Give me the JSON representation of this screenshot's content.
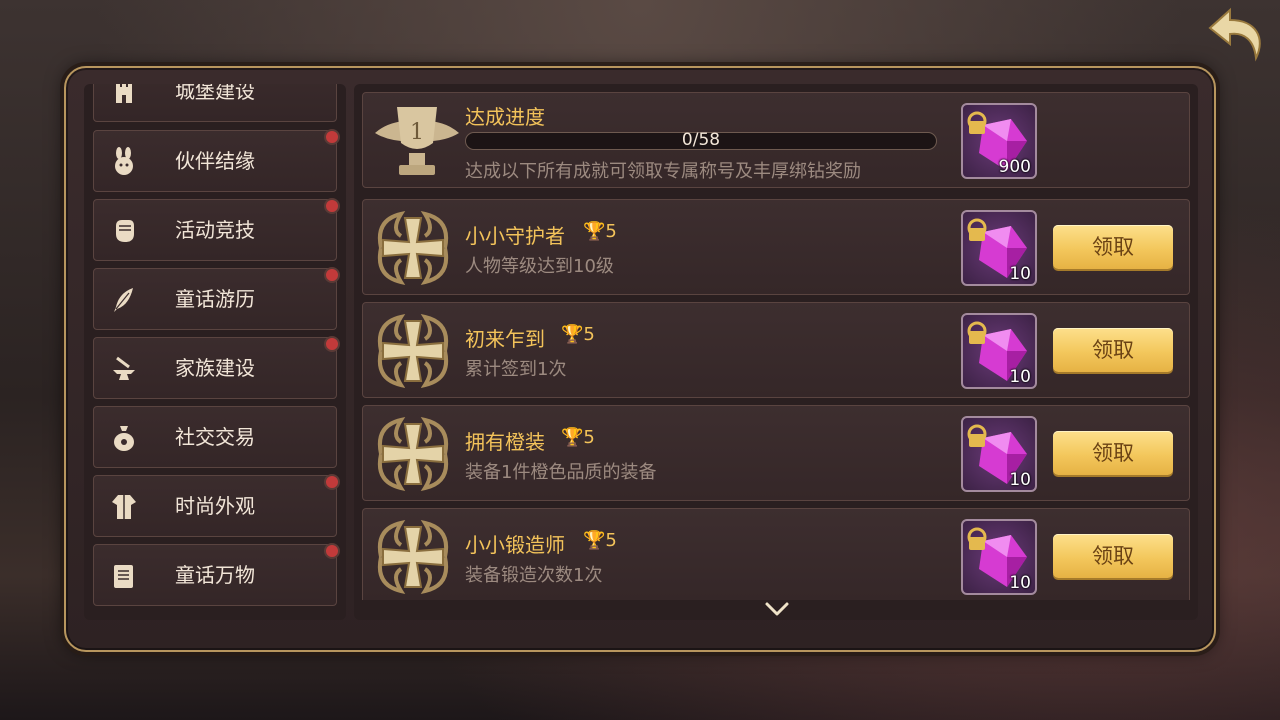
{
  "sidebar": {
    "items": [
      {
        "label": "城堡建设",
        "icon": "castle-icon",
        "badge": false
      },
      {
        "label": "伙伴结缘",
        "icon": "bunny-partner-icon",
        "badge": true
      },
      {
        "label": "活动竞技",
        "icon": "fist-icon",
        "badge": true
      },
      {
        "label": "童话游历",
        "icon": "feather-icon",
        "badge": true
      },
      {
        "label": "家族建设",
        "icon": "anvil-icon",
        "badge": true
      },
      {
        "label": "社交交易",
        "icon": "money-bag-icon",
        "badge": false
      },
      {
        "label": "时尚外观",
        "icon": "outfit-icon",
        "badge": true
      },
      {
        "label": "童话万物",
        "icon": "book-icon",
        "badge": true
      }
    ]
  },
  "progress": {
    "title": "达成进度",
    "value_text": "0/58",
    "value_fraction": 0,
    "desc": "达成以下所有成就可领取专属称号及丰厚绑钻奖励",
    "reward_qty": "900",
    "trophy_rank": "1"
  },
  "achievements": [
    {
      "title": "小小守护者",
      "points": "5",
      "desc": "人物等级达到10级",
      "reward_qty": "10",
      "button": "领取"
    },
    {
      "title": "初来乍到",
      "points": "5",
      "desc": "累计签到1次",
      "reward_qty": "10",
      "button": "领取"
    },
    {
      "title": "拥有橙装",
      "points": "5",
      "desc": "装备1件橙色品质的装备",
      "reward_qty": "10",
      "button": "领取"
    },
    {
      "title": "小小锻造师",
      "points": "5",
      "desc": "装备锻造次数1次",
      "reward_qty": "10",
      "button": "领取"
    }
  ],
  "colors": {
    "title_gold": "#f3c35a",
    "button_gold": "#f3c75c",
    "badge_red": "#c23a3a",
    "gem_magenta": "#d63bd2"
  }
}
